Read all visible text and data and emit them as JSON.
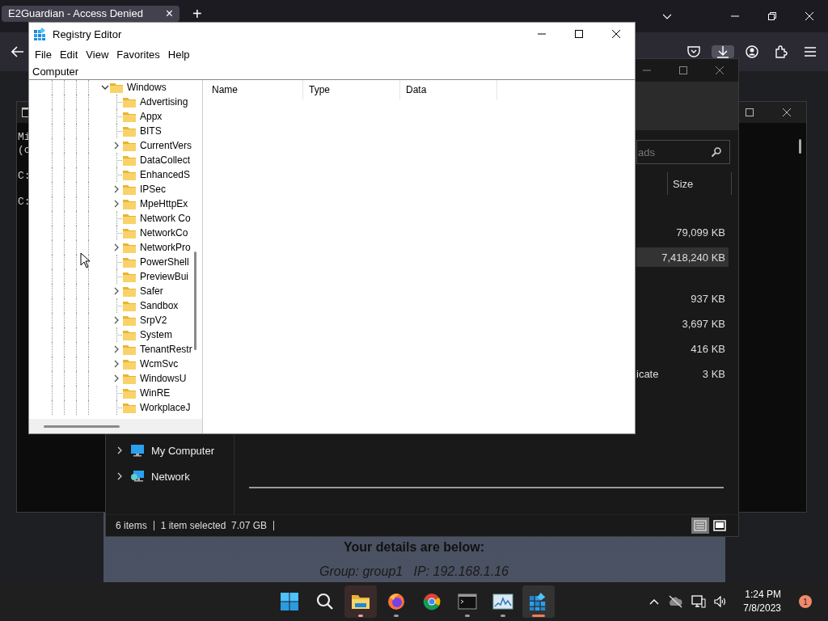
{
  "browser": {
    "tab": {
      "title": "E2Guardian - Access Denied",
      "close": "×"
    },
    "new_tab": "+",
    "page": {
      "heading": "Your details are below:",
      "details": "Group: group1   IP: 192.168.1.16"
    }
  },
  "console": {
    "blocks": [
      [
        "Mi",
        "(c"
      ],
      [
        "C:"
      ],
      [
        "C:"
      ]
    ]
  },
  "explorer": {
    "search": {
      "placeholder": "ads"
    },
    "columns": [
      "Size"
    ],
    "groups": [
      {
        "rows": [
          {
            "size": "79,099 KB",
            "selected": false
          },
          {
            "size": "7,418,240 KB",
            "selected": true
          }
        ]
      },
      {
        "rows": [
          {
            "size": "937 KB",
            "selected": false
          },
          {
            "size": "3,697 KB",
            "selected": false
          },
          {
            "size": "416 KB",
            "selected": false
          },
          {
            "name": "icate",
            "size": "3 KB",
            "selected": false
          }
        ]
      }
    ],
    "nav": [
      {
        "label": "My Computer",
        "kind": "computer"
      },
      {
        "label": "Network",
        "kind": "network"
      }
    ],
    "status": {
      "items": "6 items",
      "selection": "1 item selected  7.07 GB"
    },
    "views": [
      {
        "kind": "details",
        "selected": true
      },
      {
        "kind": "tiles",
        "selected": false
      }
    ]
  },
  "registry": {
    "title": "Registry Editor",
    "menu": [
      "File",
      "Edit",
      "View",
      "Favorites",
      "Help"
    ],
    "address": "Computer",
    "tree": {
      "label": "Windows",
      "expanded": true,
      "children": [
        {
          "label": "Advertising",
          "expandable": false
        },
        {
          "label": "Appx",
          "expandable": false
        },
        {
          "label": "BITS",
          "expandable": false
        },
        {
          "label": "CurrentVers",
          "expandable": true
        },
        {
          "label": "DataCollect",
          "expandable": false
        },
        {
          "label": "EnhancedS",
          "expandable": false
        },
        {
          "label": "IPSec",
          "expandable": true
        },
        {
          "label": "MpeHttpEx",
          "expandable": true
        },
        {
          "label": "Network Co",
          "expandable": false
        },
        {
          "label": "NetworkCo",
          "expandable": false
        },
        {
          "label": "NetworkPro",
          "expandable": true
        },
        {
          "label": "PowerShell",
          "expandable": false
        },
        {
          "label": "PreviewBui",
          "expandable": false
        },
        {
          "label": "Safer",
          "expandable": true
        },
        {
          "label": "Sandbox",
          "expandable": false
        },
        {
          "label": "SrpV2",
          "expandable": true
        },
        {
          "label": "System",
          "expandable": false
        },
        {
          "label": "TenantRestr",
          "expandable": true
        },
        {
          "label": "WcmSvc",
          "expandable": true
        },
        {
          "label": "WindowsU",
          "expandable": true
        },
        {
          "label": "WinRE",
          "expandable": false
        },
        {
          "label": "WorkplaceJ",
          "expandable": false
        }
      ]
    },
    "columns": [
      "Name",
      "Type",
      "Data"
    ]
  },
  "taskbar": {
    "apps": [
      {
        "kind": "explorer",
        "running": true,
        "active": false,
        "hovered": true
      },
      {
        "kind": "firefox",
        "running": true,
        "active": false,
        "hovered": false
      },
      {
        "kind": "chrome",
        "running": false,
        "active": false,
        "hovered": false
      },
      {
        "kind": "terminal",
        "running": true,
        "active": false,
        "hovered": false
      },
      {
        "kind": "monitor",
        "running": true,
        "active": false,
        "hovered": false
      },
      {
        "kind": "regedit",
        "running": true,
        "active": true,
        "hovered": false
      }
    ],
    "time": "1:24 PM",
    "date": "7/8/2023",
    "notifications": "1"
  }
}
